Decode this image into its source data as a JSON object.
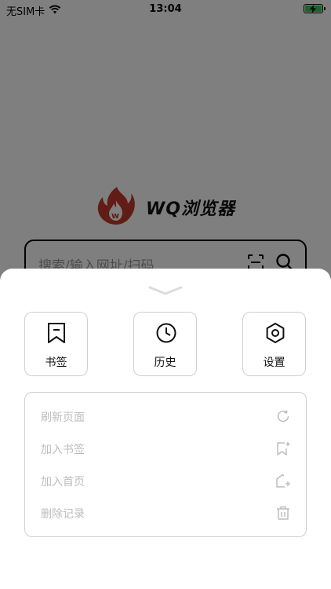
{
  "status_bar": {
    "carrier": "无SIM卡",
    "time": "13:04",
    "wifi_icon": "wifi-icon",
    "battery_icon": "battery-charging-icon",
    "battery_color": "#34c759"
  },
  "home": {
    "logo_icon": "flame-logo-icon",
    "app_name": "WQ浏览器",
    "search_placeholder": "搜索/输入网址/扫码",
    "scan_icon": "scan-icon",
    "search_icon": "search-icon"
  },
  "sheet": {
    "collapse_icon": "chevron-down-icon",
    "quick_actions": [
      {
        "label": "书签",
        "icon": "bookmark-icon"
      },
      {
        "label": "历史",
        "icon": "clock-icon"
      },
      {
        "label": "设置",
        "icon": "settings-icon"
      }
    ],
    "menu_items": [
      {
        "label": "刷新页面",
        "icon": "refresh-icon"
      },
      {
        "label": "加入书签",
        "icon": "add-bookmark-icon"
      },
      {
        "label": "加入首页",
        "icon": "add-home-icon"
      },
      {
        "label": "删除记录",
        "icon": "trash-icon"
      }
    ]
  },
  "colors": {
    "overlay": "#7f7f7f",
    "logo_red": "#c0392b",
    "disabled_text": "#bdbdbd"
  }
}
